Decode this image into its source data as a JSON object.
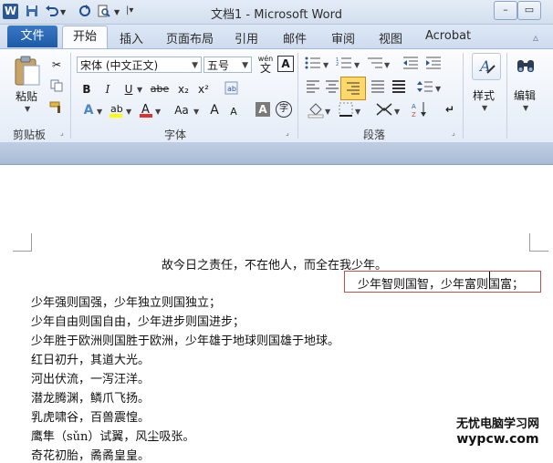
{
  "window": {
    "title": "文档1 - Microsoft Word"
  },
  "titlebar": {
    "app_icon": "W",
    "minimize": "–",
    "restore": "▭"
  },
  "tabs": {
    "file": "文件",
    "items": [
      "开始",
      "插入",
      "页面布局",
      "引用",
      "邮件",
      "审阅",
      "视图",
      "Acrobat"
    ]
  },
  "ribbon": {
    "clipboard": {
      "paste_label": "粘贴",
      "group": "剪贴板"
    },
    "font": {
      "font_name": "宋体 (中文正文)",
      "font_size": "五号",
      "group": "字体",
      "bold": "B",
      "italic": "I",
      "underline": "U",
      "strike": "abe",
      "subscript": "x₂",
      "superscript": "x²",
      "grow": "A",
      "shrink": "A",
      "case": "Aa",
      "wen": "wén",
      "a_box": "A",
      "char_border": "A",
      "enclose": "字"
    },
    "paragraph": {
      "group": "段落"
    },
    "styles": {
      "label": "样式"
    },
    "editing": {
      "label": "编辑"
    }
  },
  "document": {
    "lines": [
      "故今日之责任，不在他人，而全在我少年。",
      "少年智则国智，少年富则国富；",
      "少年强则国强，少年独立则国独立；",
      "少年自由则国自由，少年进步则国进步；",
      "少年胜于欧洲则国胜于欧洲，少年雄于地球则国雄于地球。",
      "红日初升，其道大光。",
      "河出伏流，一泻汪洋。",
      "潜龙腾渊，鳞爪飞扬。",
      "乳虎啸谷，百兽震惶。",
      "鹰隼（sǔn）试翼，风尘吸张。",
      "奇花初胎，矞矞皇皇。"
    ]
  },
  "watermark": {
    "line1": "无忧电脑学习网",
    "line2": "wypcw.com"
  },
  "colors": {
    "accent": "#1d5aa8",
    "highlight_border": "#c0504d",
    "align_active": "#ffd86b"
  }
}
